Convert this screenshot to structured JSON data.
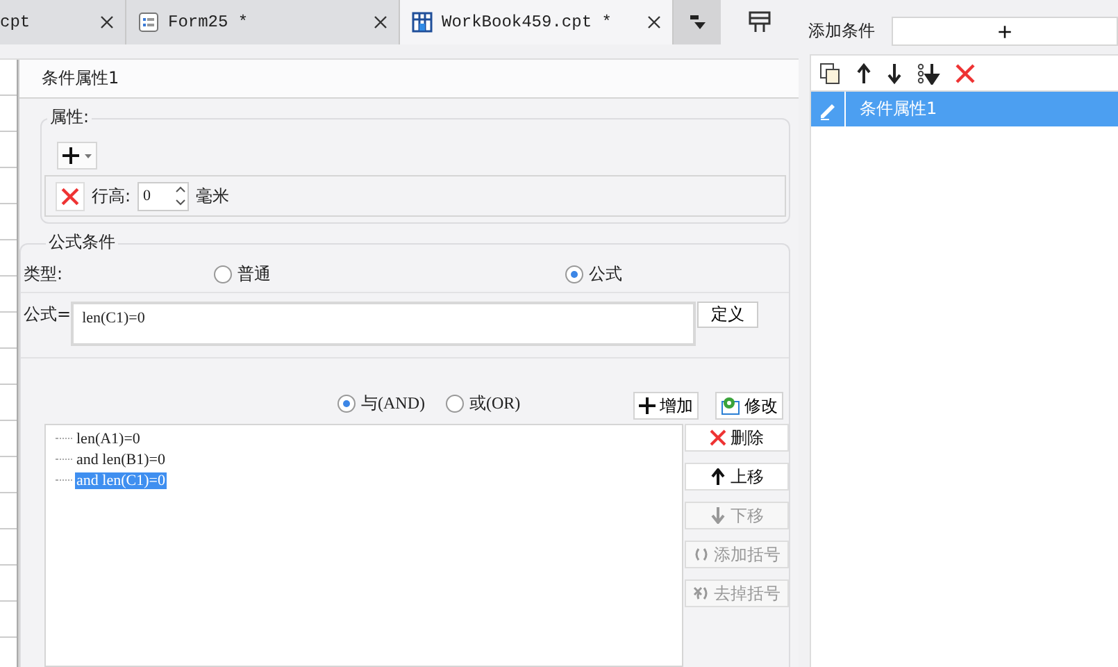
{
  "tabs": [
    {
      "label": "cpt",
      "kind": "plain",
      "selected": false
    },
    {
      "label": "Form25 *",
      "kind": "form",
      "selected": false
    },
    {
      "label": "WorkBook459.cpt *",
      "kind": "workbook",
      "selected": true
    }
  ],
  "dialog": {
    "title": "条件属性1",
    "attributes": {
      "legend": "属性:",
      "row_label": "行高:",
      "row_value": "0",
      "row_unit": "毫米"
    },
    "formula_condition": {
      "legend": "公式条件",
      "type_label": "类型:",
      "types": [
        {
          "label": "普通",
          "selected": false
        },
        {
          "label": "公式",
          "selected": true
        }
      ],
      "formula_label": "公式=",
      "formula_value": "len(C1)=0",
      "define_button": "定义",
      "logic": [
        {
          "label": "与(AND)",
          "selected": true
        },
        {
          "label": "或(OR)",
          "selected": false
        }
      ],
      "add_button": "增加",
      "modify_button": "修改",
      "conditions": [
        {
          "text": "len(A1)=0",
          "selected": false
        },
        {
          "text": "and len(B1)=0",
          "selected": false
        },
        {
          "text": "and len(C1)=0",
          "selected": true
        }
      ],
      "actions": [
        {
          "label": "删除",
          "kind": "delete",
          "disabled": false
        },
        {
          "label": "上移",
          "kind": "up",
          "disabled": false
        },
        {
          "label": "下移",
          "kind": "down",
          "disabled": true
        },
        {
          "label": "添加括号",
          "kind": "bracket",
          "disabled": true
        },
        {
          "label": "去掉括号",
          "kind": "unbracket",
          "disabled": true
        }
      ]
    }
  },
  "side": {
    "add_label": "添加条件",
    "add_button": "+",
    "items": [
      {
        "label": "条件属性1",
        "selected": true
      }
    ]
  }
}
